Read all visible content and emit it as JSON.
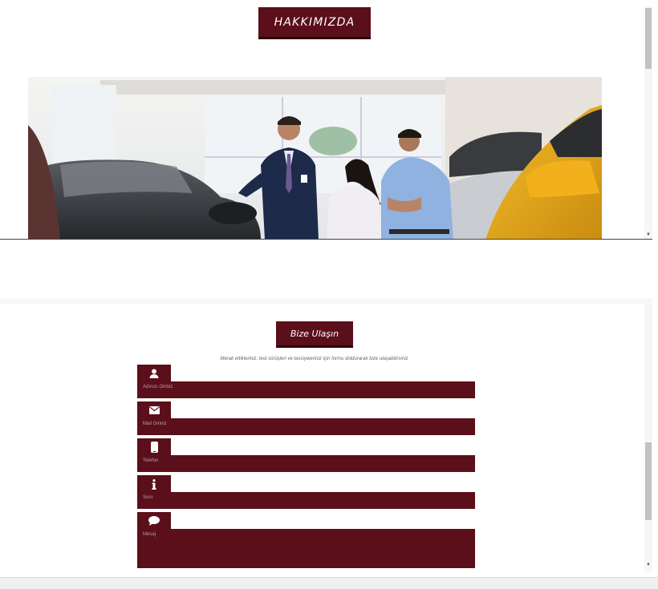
{
  "about": {
    "button_label": "HAKKIMIZDA"
  },
  "contact": {
    "button_label": "Bize Ulaşın",
    "description": "Merak ettikleriniz, test sürüşleri ve tavsiyeleriniz için formu doldurarak bize ulaşabilirsiniz",
    "fields": [
      {
        "icon": "user-icon",
        "placeholder": "Adınızı Giriniz"
      },
      {
        "icon": "envelope-icon",
        "placeholder": "Mail Giriniz"
      },
      {
        "icon": "phone-icon",
        "placeholder": "Telefon"
      },
      {
        "icon": "info-icon",
        "placeholder": "Soru"
      },
      {
        "icon": "comment-icon",
        "placeholder": "Mesaj"
      }
    ]
  },
  "colors": {
    "brand": "#5a0f1a",
    "brand_dark": "#2a050a"
  }
}
